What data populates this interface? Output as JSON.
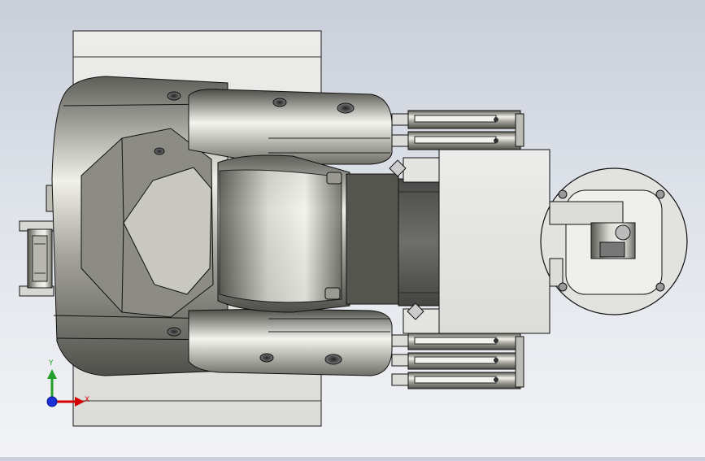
{
  "viewport": {
    "background_top": "#c9ced9",
    "background_bottom": "#f2f3f6"
  },
  "model": {
    "body_color": "#8a8a82",
    "body_highlight": "#e9e9e2",
    "edge_color": "#1a1a1a",
    "plate_color": "#e6e6e3",
    "dark_link_color": "#5c5c5a"
  },
  "triad": {
    "x_label": "X",
    "y_label": "Y",
    "x_color": "#d40000",
    "y_color": "#22a02a",
    "z_color": "#1c2fd6",
    "icon": "coordinate-triad-icon"
  }
}
